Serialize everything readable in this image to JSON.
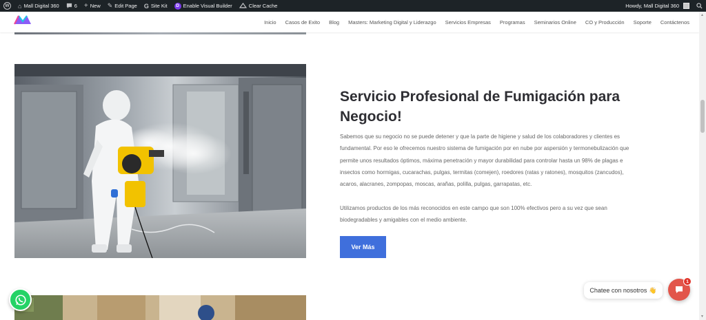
{
  "admin_bar": {
    "site_name": "Mall Digital 360",
    "comments_count": "6",
    "new_label": "New",
    "edit_page_label": "Edit Page",
    "site_kit_label": "Site Kit",
    "visual_builder_label": "Enable Visual Builder",
    "clear_cache_label": "Clear Cache",
    "howdy_label": "Howdy, Mall Digital 360"
  },
  "nav": {
    "items": [
      "Inicio",
      "Casos de Exito",
      "Blog",
      "Masters: Marketing Digital y Liderazgo",
      "Servicios Empresas",
      "Programas",
      "Seminarios Online",
      "CO y Producción",
      "Soporte",
      "Contáctenos"
    ]
  },
  "content": {
    "title": "Servicio Profesional de Fumigación para Negocio!",
    "paragraph1": "Sabemos que su negocio no se puede detener y que la parte de higiene y salud de los colaboradores y clientes es fundamental. Por eso le ofrecemos nuestro sistema de fumigación por en nube por aspersión y termonebulización que permite unos resultados óptimos, máxima penetración y mayor durabilidad para controlar hasta un 98% de plagas e insectos como hormigas, cucarachas, pulgas, termitas (comejen), roedores (ratas y ratones), mosquitos (zancudos), acaros, alacranes, zompopas, moscas, arañas, polilla, pulgas, garrapatas, etc.",
    "paragraph2": "Utilizamos productos de los más reconocidos en este campo que son 100% efectivos pero a su vez que sean biodegradables y amigables con el medio ambiente.",
    "cta_label": "Ver Más"
  },
  "chat": {
    "greeting": "Chatee con nosotros",
    "emoji": "👋",
    "badge_count": "1"
  },
  "colors": {
    "admin_bar_bg": "#1d2327",
    "button_blue": "#3f6fdc",
    "whatsapp_green": "#25d366",
    "chat_red": "#e2554a"
  }
}
